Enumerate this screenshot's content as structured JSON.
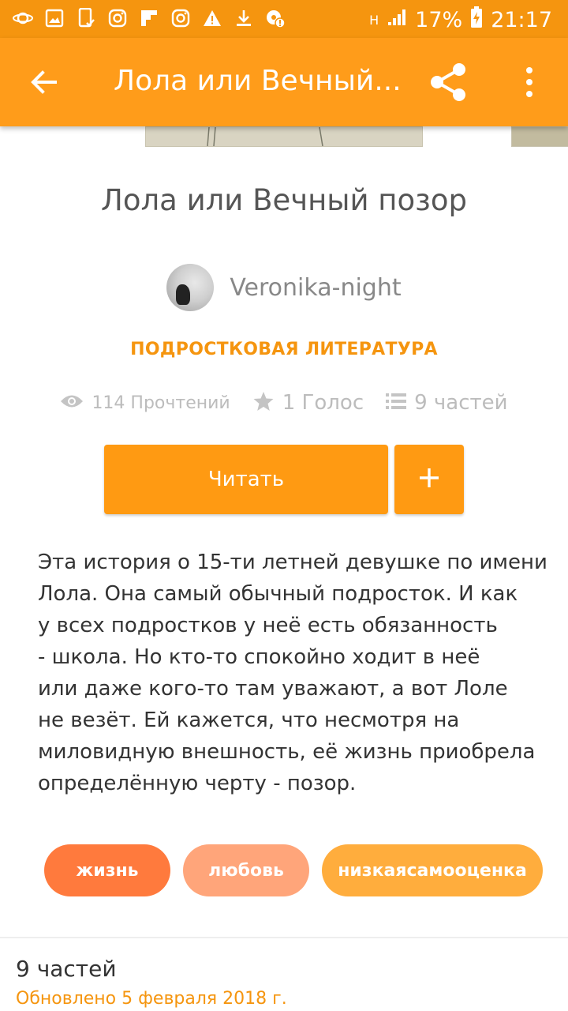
{
  "status_bar": {
    "network": "H",
    "battery": "17%",
    "time": "21:17",
    "icons": [
      "saturn-icon",
      "image-icon",
      "phone-check-icon",
      "instagram-icon",
      "flipboard-icon",
      "instagram-icon",
      "warning-icon",
      "download-icon",
      "settings-alert-icon"
    ]
  },
  "appbar": {
    "title": "Лола или Вечный..."
  },
  "story": {
    "title": "Лола или Вечный позор",
    "author": "Veronika-night",
    "category": "ПОДРОСТКОВАЯ ЛИТЕРАТУРА",
    "reads": "114 Прочтений",
    "votes": "1 Голос",
    "parts": "9 частей",
    "read_button": "Читать",
    "description_lines": [
      "Эта история о 15-ти летней девушке по имени",
      "Лола. Она самый обычный подросток. И как",
      "у всех подростков у неё есть обязанность",
      "- школа. Но кто-то спокойно ходит в неё",
      "или даже кого-то там уважают, а вот Лоле",
      "не везёт. Ей кажется, что несмотря на",
      "миловидную внешность, её жизнь приобрела",
      "определённую черту - позор."
    ],
    "tags": [
      {
        "label": "жизнь",
        "color": "#ff7a3d"
      },
      {
        "label": "любовь",
        "color": "#ffa57a"
      },
      {
        "label": "низкаясамооценка",
        "color": "#ffad3d"
      }
    ]
  },
  "parts_section": {
    "title": "9 частей",
    "updated": "Обновлено 5 февраля 2018 г."
  },
  "colors": {
    "accent": "#ff9c1a",
    "status_bar": "#f5950f"
  }
}
